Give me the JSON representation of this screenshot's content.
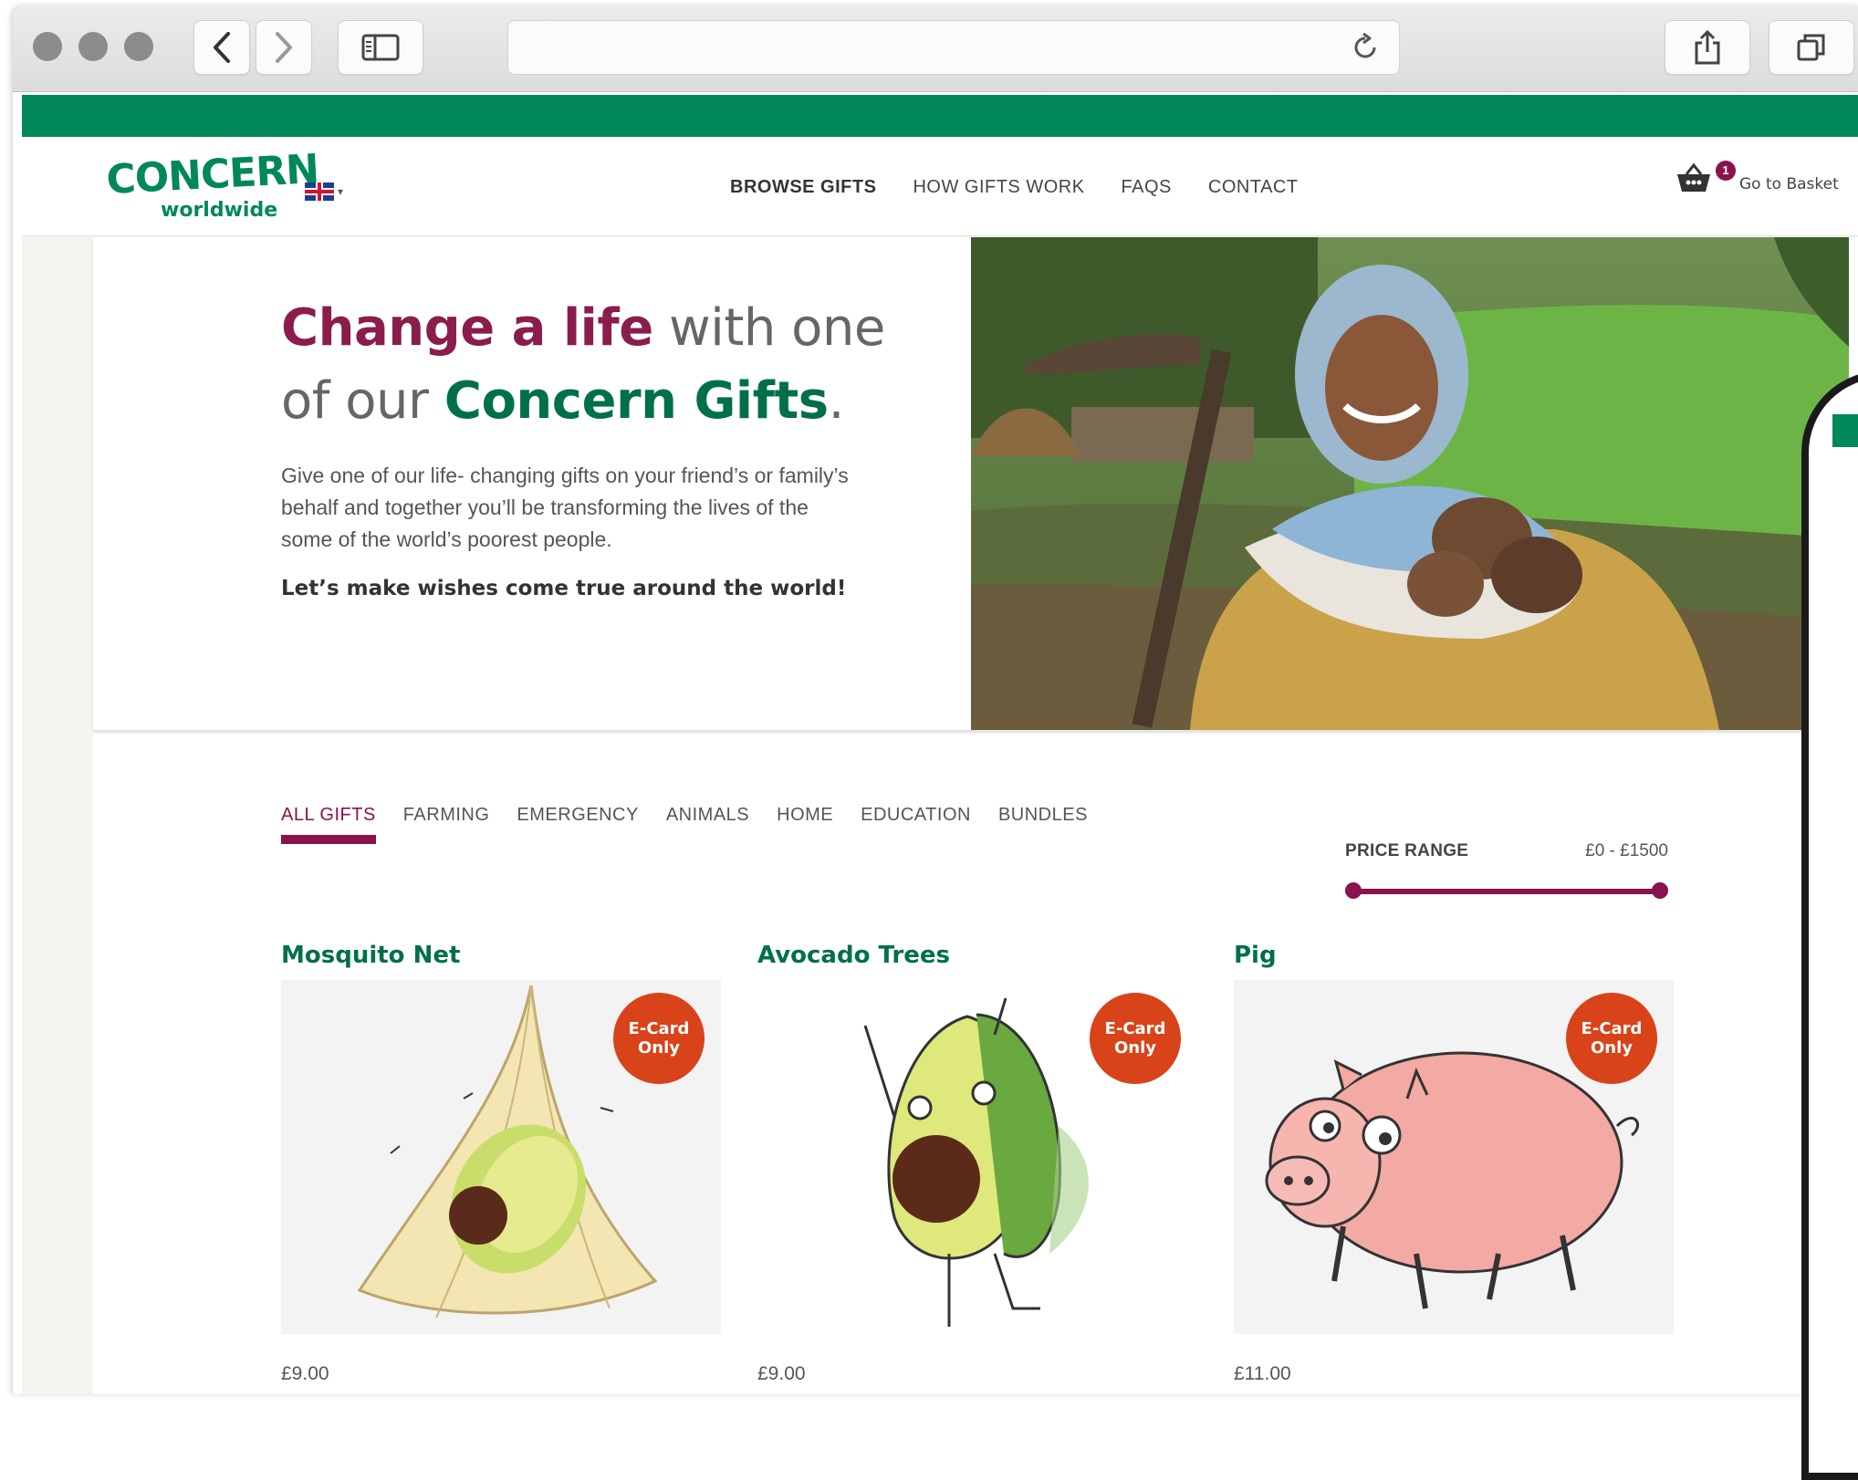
{
  "browser": {
    "traffic_lights": [
      "close",
      "minimize",
      "zoom"
    ],
    "icons": [
      "back-icon",
      "forward-icon",
      "sidebar-icon",
      "reload-icon",
      "share-icon",
      "tabs-icon"
    ]
  },
  "header": {
    "logo_main": "CONCERN",
    "logo_sub": "worldwide",
    "nav": [
      {
        "label": "BROWSE GIFTS",
        "active": true
      },
      {
        "label": "HOW GIFTS WORK",
        "active": false
      },
      {
        "label": "FAQS",
        "active": false
      },
      {
        "label": "CONTACT",
        "active": false
      }
    ],
    "basket_count": "1",
    "basket_label": "Go to Basket"
  },
  "hero": {
    "heading_part1": "Change a life",
    "heading_part2": " with one of our ",
    "heading_part3": "Concern Gifts",
    "heading_part4": ".",
    "body": "Give one of our life- changing gifts on your friend’s or family’s behalf and together you’ll be transforming the lives of the some of the world’s poorest people.",
    "cta": "Let’s make wishes come true around the world!"
  },
  "categories": [
    {
      "label": "ALL GIFTS",
      "active": true
    },
    {
      "label": "FARMING",
      "active": false
    },
    {
      "label": "EMERGENCY",
      "active": false
    },
    {
      "label": "ANIMALS",
      "active": false
    },
    {
      "label": "HOME",
      "active": false
    },
    {
      "label": "EDUCATION",
      "active": false
    },
    {
      "label": "BUNDLES",
      "active": false
    }
  ],
  "price_range": {
    "label": "PRICE RANGE",
    "value": "£0 - £1500",
    "min": 0,
    "max": 1500
  },
  "products": [
    {
      "title": "Mosquito Net",
      "price": "£9.00",
      "badge_line1": "E-Card",
      "badge_line2": "Only"
    },
    {
      "title": "Avocado Trees",
      "price": "£9.00",
      "badge_line1": "E-Card",
      "badge_line2": "Only"
    },
    {
      "title": "Pig",
      "price": "£11.00",
      "badge_line1": "E-Card",
      "badge_line2": "Only"
    }
  ],
  "colors": {
    "brand_green": "#00875a",
    "heading_green": "#00704a",
    "maroon": "#8a124e",
    "badge_orange": "#d8431a"
  }
}
